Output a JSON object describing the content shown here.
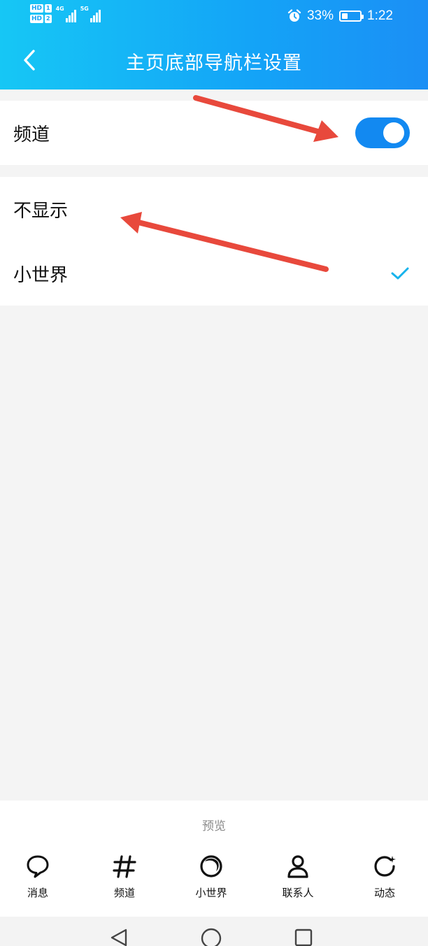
{
  "status_bar": {
    "hd1": "HD",
    "hd1_num": "1",
    "hd2": "HD",
    "hd2_num": "2",
    "net1": "4G",
    "net2": "5G",
    "battery_percent": "33%",
    "battery_level": 0.33,
    "time": "1:22",
    "alarm_icon": "alarm-clock-icon"
  },
  "header": {
    "title": "主页底部导航栏设置",
    "back_icon": "chevron-left-icon",
    "gradient": [
      "#16c7f5",
      "#1b8ff5"
    ]
  },
  "channel_row": {
    "label": "频道",
    "toggle_on": true,
    "toggle_color": "#1289f1"
  },
  "options": [
    {
      "label": "不显示",
      "selected": false
    },
    {
      "label": "小世界",
      "selected": true
    }
  ],
  "check_color": "#17b3ec",
  "annotation_color": "#e8493c",
  "preview": {
    "label": "预览",
    "items": [
      {
        "label": "消息",
        "icon": "chat-bubble-icon"
      },
      {
        "label": "频道",
        "icon": "hash-icon"
      },
      {
        "label": "小世界",
        "icon": "planet-icon"
      },
      {
        "label": "联系人",
        "icon": "person-icon"
      },
      {
        "label": "动态",
        "icon": "refresh-star-icon"
      }
    ]
  },
  "system_nav": {
    "back": "triangle-back-icon",
    "home": "circle-home-icon",
    "recents": "square-recents-icon"
  }
}
